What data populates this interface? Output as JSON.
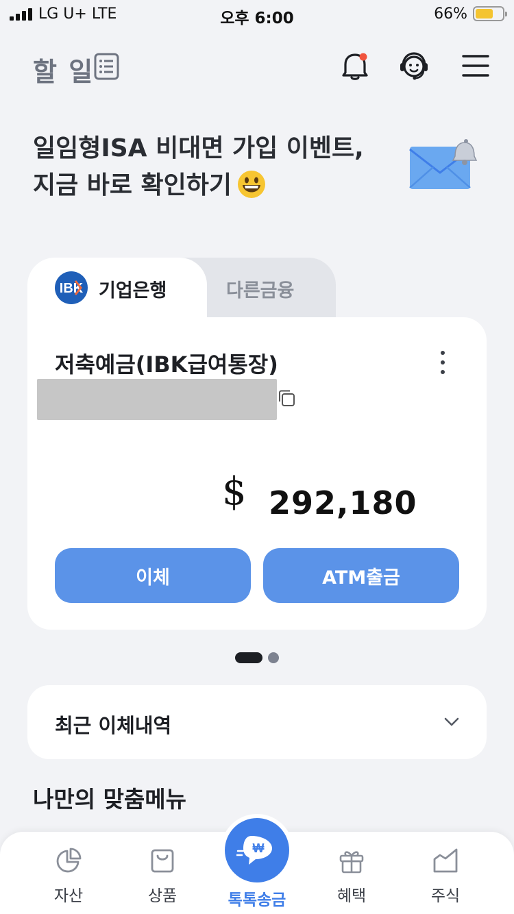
{
  "status_bar": {
    "carrier": "LG U+  LTE",
    "time": "오후 6:00",
    "battery_percent": "66%",
    "battery_level": 0.66
  },
  "header": {
    "title": "할 일",
    "icons": [
      "list-icon",
      "bell-icon",
      "support-headset-icon",
      "hamburger-menu-icon"
    ],
    "notification_dot_color": "#f0533d"
  },
  "promo": {
    "line1": "일임형ISA 비대면 가입 이벤트,",
    "line2": "지금 바로 확인하기",
    "icons": [
      "smile-emoji-icon",
      "envelope-bell-icon"
    ]
  },
  "account_tabs": [
    {
      "label": "기업은행",
      "active": true
    },
    {
      "label": "다른금융",
      "active": false
    }
  ],
  "account": {
    "name": "저축예금(IBK급여통장)",
    "currency_symbol": "$",
    "balance": "292,180",
    "buttons": {
      "transfer": "이체",
      "atm": "ATM출금"
    }
  },
  "pager": {
    "count": 2,
    "active_index": 0
  },
  "recent": {
    "label": "최근 이체내역"
  },
  "custom_menu": {
    "title": "나만의 맞춤메뉴"
  },
  "bottom_nav": [
    {
      "label": "자산",
      "icon": "pie-chart-icon"
    },
    {
      "label": "상품",
      "icon": "shopping-bag-icon"
    },
    {
      "label": "톡톡송금",
      "icon": "chat-won-icon",
      "active": true
    },
    {
      "label": "혜택",
      "icon": "gift-icon"
    },
    {
      "label": "주식",
      "icon": "stock-chart-icon"
    }
  ],
  "colors": {
    "accent": "#3f7ee8",
    "button": "#5b93e8",
    "background": "#f2f3f6",
    "ibk_blue": "#1f5fb8"
  }
}
